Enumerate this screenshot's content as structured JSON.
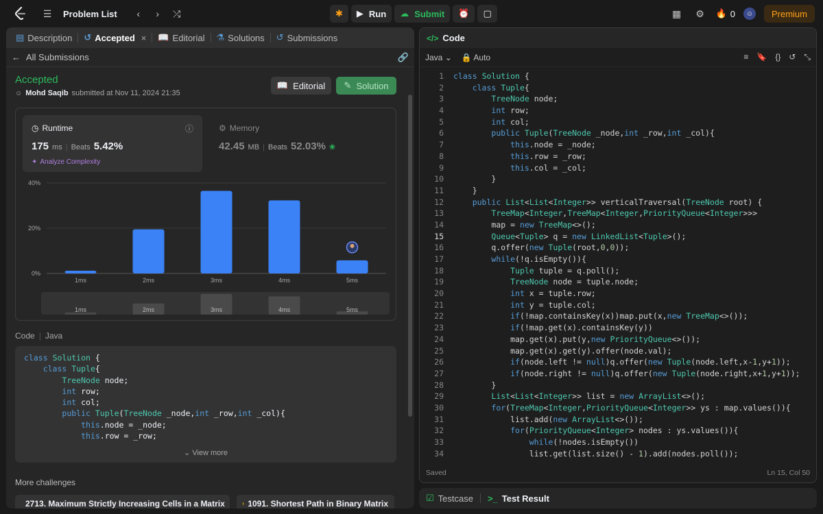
{
  "topbar": {
    "title": "Problem List",
    "run_label": "Run",
    "submit_label": "Submit",
    "streak_count": "0",
    "premium_label": "Premium"
  },
  "left": {
    "tabs": [
      {
        "label": "Description"
      },
      {
        "label": "Accepted"
      },
      {
        "label": "Editorial"
      },
      {
        "label": "Solutions"
      },
      {
        "label": "Submissions"
      }
    ],
    "back_label": "All Submissions",
    "status": "Accepted",
    "author": "Mohd Saqib",
    "submitted_text": "submitted at Nov 11, 2024 21:35",
    "editorial_button": "Editorial",
    "solution_button": "Solution",
    "runtime": {
      "heading": "Runtime",
      "value": "175",
      "unit": "ms",
      "beats_label": "Beats",
      "beats_pct": "5.42%",
      "analyze": "Analyze Complexity"
    },
    "memory": {
      "heading": "Memory",
      "value": "42.45",
      "unit": "MB",
      "beats_label": "Beats",
      "beats_pct": "52.03%"
    },
    "code_label": "Code",
    "code_lang": "Java",
    "code_preview": [
      "class Solution {",
      "    class Tuple{",
      "        TreeNode node;",
      "        int row;",
      "        int col;",
      "        public Tuple(TreeNode _node,int _row,int _col){",
      "            this.node = _node;",
      "            this.row = _row;"
    ],
    "view_more": "View more",
    "more_challenges": "More challenges",
    "challenges": [
      {
        "label": "2713. Maximum Strictly Increasing Cells in a Matrix",
        "color": "#f63737"
      },
      {
        "label": "1091. Shortest Path in Binary Matrix",
        "color": "#ffb800"
      }
    ]
  },
  "chart_data": {
    "type": "bar",
    "categories": [
      "1ms",
      "2ms",
      "3ms",
      "4ms",
      "5ms"
    ],
    "values": [
      1.2,
      19.5,
      36.5,
      32.3,
      5.8
    ],
    "ylim": [
      0,
      40
    ],
    "yticks": [
      "0%",
      "20%",
      "40%"
    ],
    "overview_values": [
      1.2,
      19.5,
      36.5,
      32.3,
      5.8
    ],
    "bar_color": "#3b82f6",
    "highlight_category": "5ms"
  },
  "editor": {
    "panel_title": "Code",
    "language": "Java",
    "mode": "Auto",
    "status": "Saved",
    "cursor": "Ln 15, Col 50",
    "current_line": 15,
    "lines": [
      "class Solution {",
      "    class Tuple{",
      "        TreeNode node;",
      "        int row;",
      "        int col;",
      "        public Tuple(TreeNode _node,int _row,int _col){",
      "            this.node = _node;",
      "            this.row = _row;",
      "            this.col = _col;",
      "        }",
      "    }",
      "    public List<List<Integer>> verticalTraversal(TreeNode root) {",
      "        TreeMap<Integer,TreeMap<Integer,PriorityQueue<Integer>>>",
      "        map = new TreeMap<>();",
      "        Queue<Tuple> q = new LinkedList<Tuple>();",
      "        q.offer(new Tuple(root,0,0));",
      "        while(!q.isEmpty()){",
      "            Tuple tuple = q.poll();",
      "            TreeNode node = tuple.node;",
      "            int x = tuple.row;",
      "            int y = tuple.col;",
      "            if(!map.containsKey(x))map.put(x,new TreeMap<>());",
      "            if(!map.get(x).containsKey(y))",
      "            map.get(x).put(y,new PriorityQueue<>());",
      "            map.get(x).get(y).offer(node.val);",
      "            if(node.left != null)q.offer(new Tuple(node.left,x-1,y+1));",
      "            if(node.right != null)q.offer(new Tuple(node.right,x+1,y+1));",
      "        }",
      "        List<List<Integer>> list = new ArrayList<>();",
      "        for(TreeMap<Integer,PriorityQueue<Integer>> ys : map.values()){",
      "            list.add(new ArrayList<>());",
      "            for(PriorityQueue<Integer> nodes : ys.values()){",
      "                while(!nodes.isEmpty())",
      "                list.get(list.size() - 1).add(nodes.poll());"
    ]
  },
  "test_panel": {
    "testcase_label": "Testcase",
    "result_label": "Test Result"
  }
}
